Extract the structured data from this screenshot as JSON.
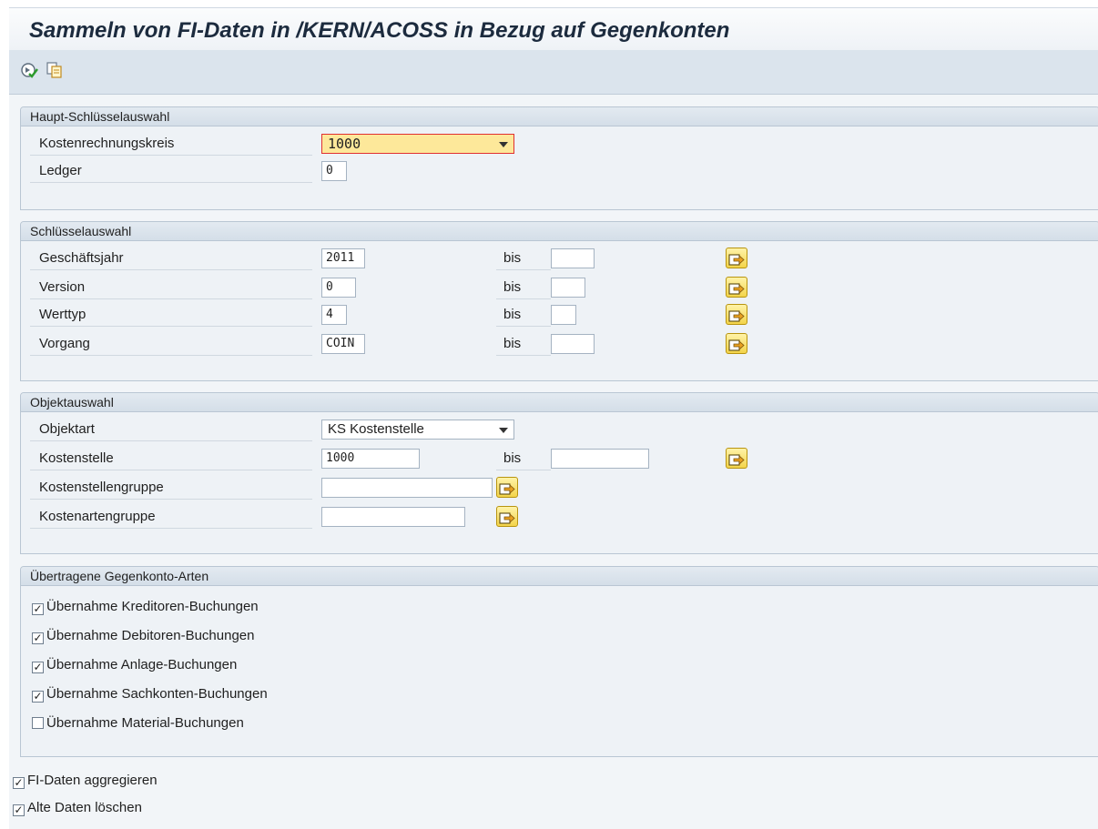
{
  "title": "Sammeln von FI-Daten in /KERN/ACOSS in Bezug auf Gegenkonten",
  "toolbar": {
    "execute_icon": "execute-icon",
    "variant_icon": "get-variant-icon"
  },
  "haupt": {
    "header": "Haupt-Schlüsselauswahl",
    "kostenrechnungskreis_label": "Kostenrechnungskreis",
    "kostenrechnungskreis_value": "1000",
    "ledger_label": "Ledger",
    "ledger_value": "0"
  },
  "schluessel": {
    "header": "Schlüsselauswahl",
    "bis": "bis",
    "rows": [
      {
        "label": "Geschäftsjahr",
        "from": "2011",
        "to": ""
      },
      {
        "label": "Version",
        "from": "0",
        "to": ""
      },
      {
        "label": "Werttyp",
        "from": "4",
        "to": ""
      },
      {
        "label": "Vorgang",
        "from": "COIN",
        "to": ""
      }
    ]
  },
  "objekt": {
    "header": "Objektauswahl",
    "objektart_label": "Objektart",
    "objektart_value": "KS Kostenstelle",
    "kostenstelle_label": "Kostenstelle",
    "kostenstelle_from": "1000",
    "kostenstelle_to": "",
    "bis": "bis",
    "kostenstellengruppe_label": "Kostenstellengruppe",
    "kostenstellengruppe_value": "",
    "kostenartengruppe_label": "Kostenartengruppe",
    "kostenartengruppe_value": ""
  },
  "gegenkonto": {
    "header": "Übertragene Gegenkonto-Arten",
    "options": [
      {
        "label": "Übernahme Kreditoren-Buchungen",
        "checked": true
      },
      {
        "label": "Übernahme Debitoren-Buchungen",
        "checked": true
      },
      {
        "label": "Übernahme Anlage-Buchungen",
        "checked": true
      },
      {
        "label": "Übernahme Sachkonten-Buchungen",
        "checked": true
      },
      {
        "label": "Übernahme Material-Buchungen",
        "checked": false
      }
    ]
  },
  "bottom": {
    "options": [
      {
        "label": "FI-Daten aggregieren",
        "checked": true
      },
      {
        "label": "Alte Daten löschen",
        "checked": true
      }
    ]
  },
  "colors": {
    "accent_focus": "#fde89a",
    "focus_border": "#e03030",
    "select_button": "#f3d44a"
  }
}
